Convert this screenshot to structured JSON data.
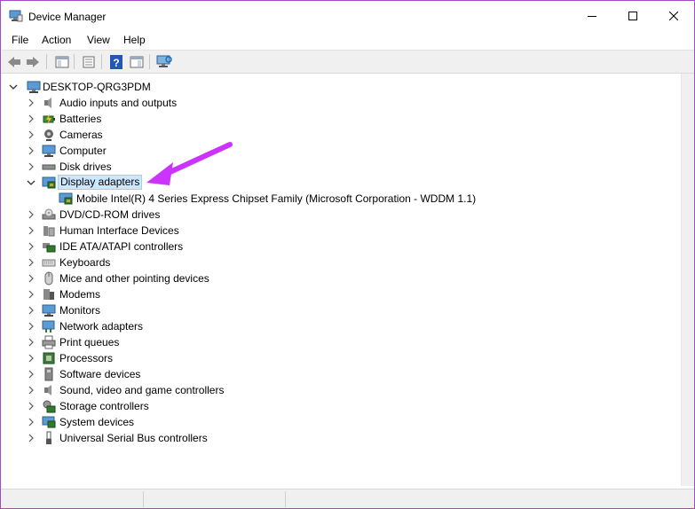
{
  "window": {
    "title": "Device Manager"
  },
  "menubar": {
    "items": [
      "File",
      "Action",
      "View",
      "Help"
    ]
  },
  "toolbar": {
    "buttons": [
      "back-icon",
      "forward-icon",
      "console-tree-icon",
      "properties-icon",
      "help-icon",
      "action-pane-icon",
      "scan-hardware-icon"
    ]
  },
  "tree": {
    "root": "DESKTOP-QRG3PDM",
    "categories": [
      {
        "label": "Audio inputs and outputs",
        "icon": "speaker-icon",
        "expanded": false
      },
      {
        "label": "Batteries",
        "icon": "battery-icon",
        "expanded": false
      },
      {
        "label": "Cameras",
        "icon": "camera-icon",
        "expanded": false
      },
      {
        "label": "Computer",
        "icon": "monitor-icon",
        "expanded": false
      },
      {
        "label": "Disk drives",
        "icon": "disk-drive-icon",
        "expanded": false
      },
      {
        "label": "Display adapters",
        "icon": "display-adapter-icon",
        "expanded": true,
        "selected": true
      },
      {
        "label": "DVD/CD-ROM drives",
        "icon": "dvd-drive-icon",
        "expanded": false
      },
      {
        "label": "Human Interface Devices",
        "icon": "hid-icon",
        "expanded": false
      },
      {
        "label": "IDE ATA/ATAPI controllers",
        "icon": "ide-controller-icon",
        "expanded": false
      },
      {
        "label": "Keyboards",
        "icon": "keyboard-icon",
        "expanded": false
      },
      {
        "label": "Mice and other pointing devices",
        "icon": "mouse-icon",
        "expanded": false
      },
      {
        "label": "Modems",
        "icon": "modem-icon",
        "expanded": false
      },
      {
        "label": "Monitors",
        "icon": "monitor-icon",
        "expanded": false
      },
      {
        "label": "Network adapters",
        "icon": "network-adapter-icon",
        "expanded": false
      },
      {
        "label": "Print queues",
        "icon": "printer-icon",
        "expanded": false
      },
      {
        "label": "Processors",
        "icon": "processor-icon",
        "expanded": false
      },
      {
        "label": "Software devices",
        "icon": "software-device-icon",
        "expanded": false
      },
      {
        "label": "Sound, video and game controllers",
        "icon": "speaker-icon",
        "expanded": false
      },
      {
        "label": "Storage controllers",
        "icon": "storage-controller-icon",
        "expanded": false
      },
      {
        "label": "System devices",
        "icon": "system-device-icon",
        "expanded": false
      },
      {
        "label": "Universal Serial Bus controllers",
        "icon": "usb-icon",
        "expanded": false
      }
    ],
    "children": {
      "display_adapters": [
        "Mobile Intel(R) 4 Series Express Chipset Family (Microsoft Corporation - WDDM 1.1)"
      ]
    }
  },
  "colors": {
    "selection_bg": "#cce8ff",
    "selection_border": "#99d1ff",
    "annotation_arrow": "#cc33ff",
    "window_border": "#a24bc6"
  }
}
